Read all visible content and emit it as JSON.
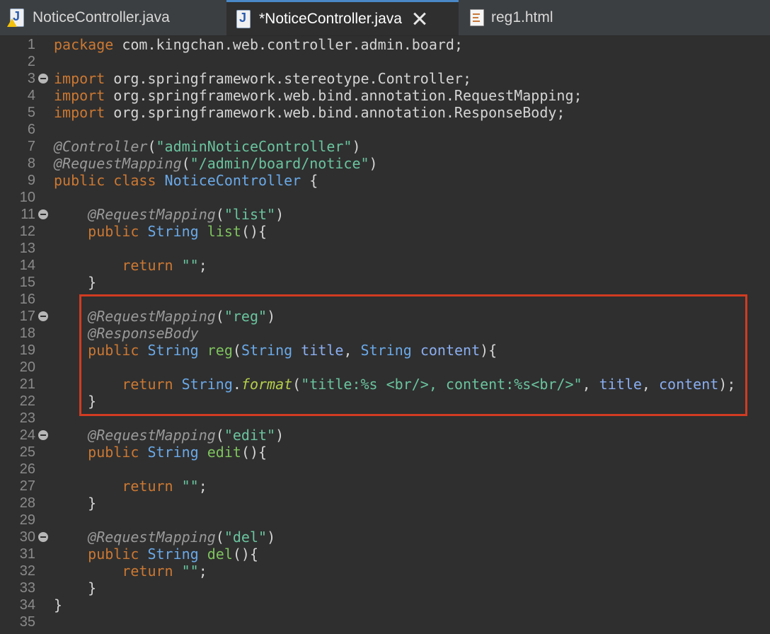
{
  "tabs": [
    {
      "label": "NoticeController.java",
      "icon": "java-file-warning-icon"
    },
    {
      "label": "*NoticeController.java",
      "icon": "java-file-icon",
      "active": true
    },
    {
      "label": "reg1.html",
      "icon": "html-file-icon"
    }
  ],
  "code_lines": [
    {
      "n": "1",
      "fold": false,
      "segs": [
        [
          "k",
          "package"
        ],
        [
          "pl",
          " com.kingchan.web.controller.admin.board;"
        ]
      ]
    },
    {
      "n": "2",
      "fold": false,
      "segs": []
    },
    {
      "n": "3",
      "fold": true,
      "segs": [
        [
          "k",
          "import"
        ],
        [
          "pl",
          " org.springframework.stereotype.Controller;"
        ]
      ]
    },
    {
      "n": "4",
      "fold": false,
      "segs": [
        [
          "k",
          "import"
        ],
        [
          "pl",
          " org.springframework.web.bind.annotation.RequestMapping;"
        ]
      ]
    },
    {
      "n": "5",
      "fold": false,
      "segs": [
        [
          "k",
          "import"
        ],
        [
          "pl",
          " org.springframework.web.bind.annotation.ResponseBody;"
        ]
      ]
    },
    {
      "n": "6",
      "fold": false,
      "segs": []
    },
    {
      "n": "7",
      "fold": false,
      "segs": [
        [
          "an",
          "@Controller"
        ],
        [
          "pl",
          "("
        ],
        [
          "st",
          "\"adminNoticeController\""
        ],
        [
          "pl",
          ")"
        ]
      ]
    },
    {
      "n": "8",
      "fold": false,
      "segs": [
        [
          "an",
          "@RequestMapping"
        ],
        [
          "pl",
          "("
        ],
        [
          "st",
          "\"/admin/board/notice\""
        ],
        [
          "pl",
          ")"
        ]
      ]
    },
    {
      "n": "9",
      "fold": false,
      "segs": [
        [
          "k",
          "public class "
        ],
        [
          "ty",
          "NoticeController"
        ],
        [
          "pl",
          " {"
        ]
      ]
    },
    {
      "n": "10",
      "fold": false,
      "segs": []
    },
    {
      "n": "11",
      "fold": true,
      "segs": [
        [
          "pl",
          "    "
        ],
        [
          "an",
          "@RequestMapping"
        ],
        [
          "pl",
          "("
        ],
        [
          "st",
          "\"list\""
        ],
        [
          "pl",
          ")"
        ]
      ]
    },
    {
      "n": "12",
      "fold": false,
      "segs": [
        [
          "pl",
          "    "
        ],
        [
          "k",
          "public "
        ],
        [
          "ty",
          "String "
        ],
        [
          "fn",
          "list"
        ],
        [
          "pl",
          "(){"
        ]
      ]
    },
    {
      "n": "13",
      "fold": false,
      "segs": []
    },
    {
      "n": "14",
      "fold": false,
      "segs": [
        [
          "pl",
          "        "
        ],
        [
          "k",
          "return "
        ],
        [
          "st",
          "\"\""
        ],
        [
          "pl",
          ";"
        ]
      ]
    },
    {
      "n": "15",
      "fold": false,
      "segs": [
        [
          "pl",
          "    }"
        ]
      ]
    },
    {
      "n": "16",
      "fold": false,
      "segs": []
    },
    {
      "n": "17",
      "fold": true,
      "segs": [
        [
          "pl",
          "    "
        ],
        [
          "an",
          "@RequestMapping"
        ],
        [
          "pl",
          "("
        ],
        [
          "st",
          "\"reg\""
        ],
        [
          "pl",
          ")"
        ]
      ]
    },
    {
      "n": "18",
      "fold": false,
      "segs": [
        [
          "pl",
          "    "
        ],
        [
          "an",
          "@ResponseBody"
        ]
      ]
    },
    {
      "n": "19",
      "fold": false,
      "segs": [
        [
          "pl",
          "    "
        ],
        [
          "k",
          "public "
        ],
        [
          "ty",
          "String "
        ],
        [
          "fn",
          "reg"
        ],
        [
          "pl",
          "("
        ],
        [
          "ty",
          "String "
        ],
        [
          "pa",
          "title"
        ],
        [
          "pl",
          ", "
        ],
        [
          "ty",
          "String "
        ],
        [
          "pa",
          "content"
        ],
        [
          "pl",
          "){"
        ]
      ]
    },
    {
      "n": "20",
      "fold": false,
      "segs": []
    },
    {
      "n": "21",
      "fold": false,
      "segs": [
        [
          "pl",
          "        "
        ],
        [
          "k",
          "return "
        ],
        [
          "ty",
          "String"
        ],
        [
          "pl",
          "."
        ],
        [
          "fi",
          "format"
        ],
        [
          "pl",
          "("
        ],
        [
          "st",
          "\"title:%s <br/>, content:%s<br/>\""
        ],
        [
          "pl",
          ", "
        ],
        [
          "pa",
          "title"
        ],
        [
          "pl",
          ", "
        ],
        [
          "pa",
          "content"
        ],
        [
          "pl",
          ");"
        ]
      ]
    },
    {
      "n": "22",
      "fold": false,
      "segs": [
        [
          "pl",
          "    }"
        ]
      ]
    },
    {
      "n": "23",
      "fold": false,
      "segs": []
    },
    {
      "n": "24",
      "fold": true,
      "segs": [
        [
          "pl",
          "    "
        ],
        [
          "an",
          "@RequestMapping"
        ],
        [
          "pl",
          "("
        ],
        [
          "st",
          "\"edit\""
        ],
        [
          "pl",
          ")"
        ]
      ]
    },
    {
      "n": "25",
      "fold": false,
      "segs": [
        [
          "pl",
          "    "
        ],
        [
          "k",
          "public "
        ],
        [
          "ty",
          "String "
        ],
        [
          "fn",
          "edit"
        ],
        [
          "pl",
          "(){"
        ]
      ]
    },
    {
      "n": "26",
      "fold": false,
      "segs": []
    },
    {
      "n": "27",
      "fold": false,
      "segs": [
        [
          "pl",
          "        "
        ],
        [
          "k",
          "return "
        ],
        [
          "st",
          "\"\""
        ],
        [
          "pl",
          ";"
        ]
      ]
    },
    {
      "n": "28",
      "fold": false,
      "segs": [
        [
          "pl",
          "    }"
        ]
      ]
    },
    {
      "n": "29",
      "fold": false,
      "segs": []
    },
    {
      "n": "30",
      "fold": true,
      "segs": [
        [
          "pl",
          "    "
        ],
        [
          "an",
          "@RequestMapping"
        ],
        [
          "pl",
          "("
        ],
        [
          "st",
          "\"del\""
        ],
        [
          "pl",
          ")"
        ]
      ]
    },
    {
      "n": "31",
      "fold": false,
      "segs": [
        [
          "pl",
          "    "
        ],
        [
          "k",
          "public "
        ],
        [
          "ty",
          "String "
        ],
        [
          "fn",
          "del"
        ],
        [
          "pl",
          "(){"
        ]
      ]
    },
    {
      "n": "32",
      "fold": false,
      "segs": [
        [
          "pl",
          "        "
        ],
        [
          "k",
          "return "
        ],
        [
          "st",
          "\"\""
        ],
        [
          "pl",
          ";"
        ]
      ]
    },
    {
      "n": "33",
      "fold": false,
      "segs": [
        [
          "pl",
          "    }"
        ]
      ]
    },
    {
      "n": "34",
      "fold": false,
      "segs": [
        [
          "pl",
          "}"
        ]
      ]
    },
    {
      "n": "35",
      "fold": false,
      "segs": []
    }
  ],
  "colors": {
    "highlight_box": "#d13b21",
    "background": "#2f2f2f"
  }
}
